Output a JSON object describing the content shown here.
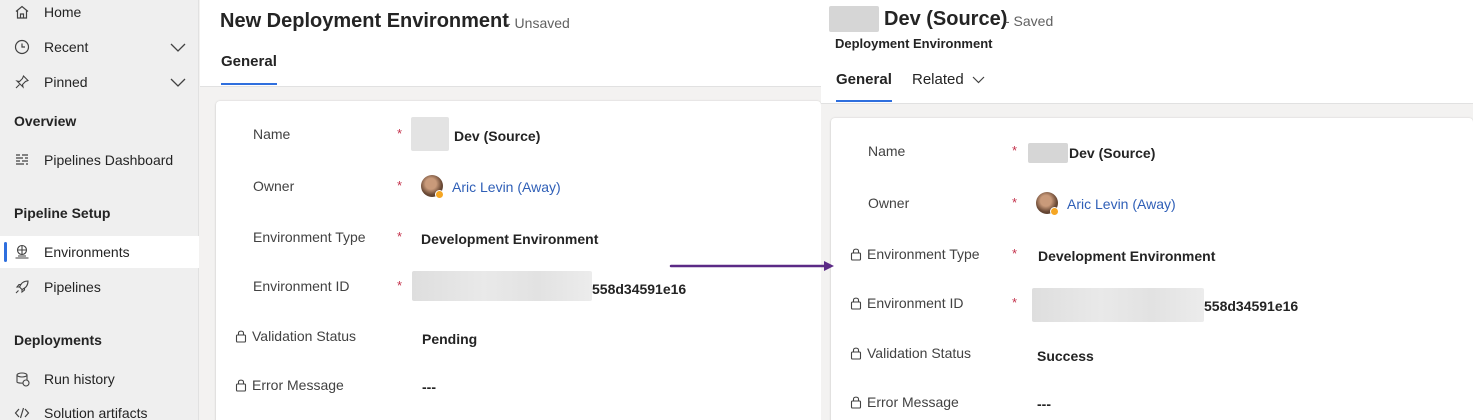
{
  "sidebar": {
    "home": "Home",
    "recent": "Recent",
    "pinned": "Pinned",
    "overview_title": "Overview",
    "pipelines_dashboard": "Pipelines Dashboard",
    "pipeline_setup_title": "Pipeline Setup",
    "environments": "Environments",
    "pipelines": "Pipelines",
    "deployments_title": "Deployments",
    "run_history": "Run history",
    "solution_artifacts": "Solution artifacts"
  },
  "left_form": {
    "title": "New Deployment Environment",
    "status": "- Unsaved",
    "tab_general": "General",
    "fields": {
      "name_label": "Name",
      "name_value": "Dev (Source)",
      "owner_label": "Owner",
      "owner_value": "Aric Levin (Away)",
      "env_type_label": "Environment Type",
      "env_type_value": "Development Environment",
      "env_id_label": "Environment ID",
      "env_id_value": "558d34591e16",
      "validation_label": "Validation Status",
      "validation_value": "Pending",
      "error_label": "Error Message",
      "error_value": "---"
    }
  },
  "right_form": {
    "title": "Dev (Source)",
    "status": "- Saved",
    "subtitle": "Deployment Environment",
    "tab_general": "General",
    "tab_related": "Related",
    "fields": {
      "name_label": "Name",
      "name_value": "Dev (Source)",
      "owner_label": "Owner",
      "owner_value": "Aric Levin (Away)",
      "env_type_label": "Environment Type",
      "env_type_value": "Development Environment",
      "env_id_label": "Environment ID",
      "env_id_value": "558d34591e16",
      "validation_label": "Validation Status",
      "validation_value": "Success",
      "error_label": "Error Message",
      "error_value": "---"
    }
  },
  "required_marker": "*",
  "colors": {
    "accent": "#2f6fde",
    "link": "#2f5fb7",
    "required": "#c4314b",
    "arrow": "#5b2a86"
  }
}
